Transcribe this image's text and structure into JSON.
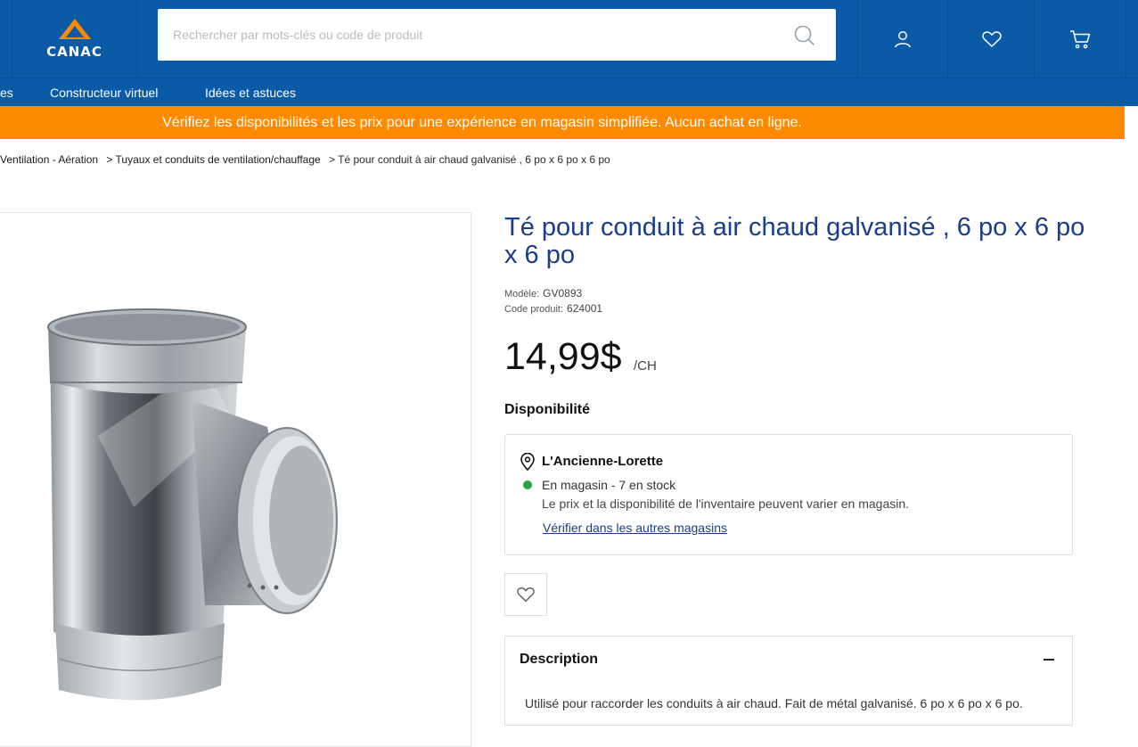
{
  "header": {
    "logo_text": "CANAC",
    "search_placeholder": "Rechercher par mots-clés ou code de produit",
    "icons": [
      "search-icon",
      "user-icon",
      "heart-icon",
      "cart-icon"
    ]
  },
  "nav": {
    "items": [
      "es",
      "Constructeur virtuel",
      "Idées et astuces"
    ]
  },
  "promo": "Vérifiez les disponibilités et les prix pour une expérience en magasin simplifiée. Aucun achat en ligne.",
  "breadcrumb": [
    "Ventilation - Aération",
    "> Tuyaux et conduits de ventilation/chauffage",
    "> Té pour conduit à air chaud galvanisé , 6 po x 6 po x 6 po"
  ],
  "product": {
    "title": "Té pour conduit à air chaud galvanisé , 6 po x 6 po x 6 po",
    "model_label": "Modèle:",
    "model_value": "GV0893",
    "code_label": "Code produit:",
    "code_value": "624001",
    "price": "14,99$",
    "unit": "/CH"
  },
  "availability": {
    "heading": "Disponibilité",
    "store": "L'Ancienne-Lorette",
    "stock": "En magasin - 7 en stock",
    "note": "Le prix et la disponibilité de l'inventaire peuvent varier en magasin.",
    "link": "Vérifier dans les autres magasins",
    "stock_color": "#26a744"
  },
  "description": {
    "heading": "Description",
    "text": "Utilisé pour raccorder les conduits à air chaud. Fait de métal galvanisé. 6 po x 6 po x 6 po."
  },
  "colors": {
    "brand_blue": "#0b5aa6",
    "promo_orange": "#ff8a00",
    "title_blue": "#1c3d8c"
  }
}
